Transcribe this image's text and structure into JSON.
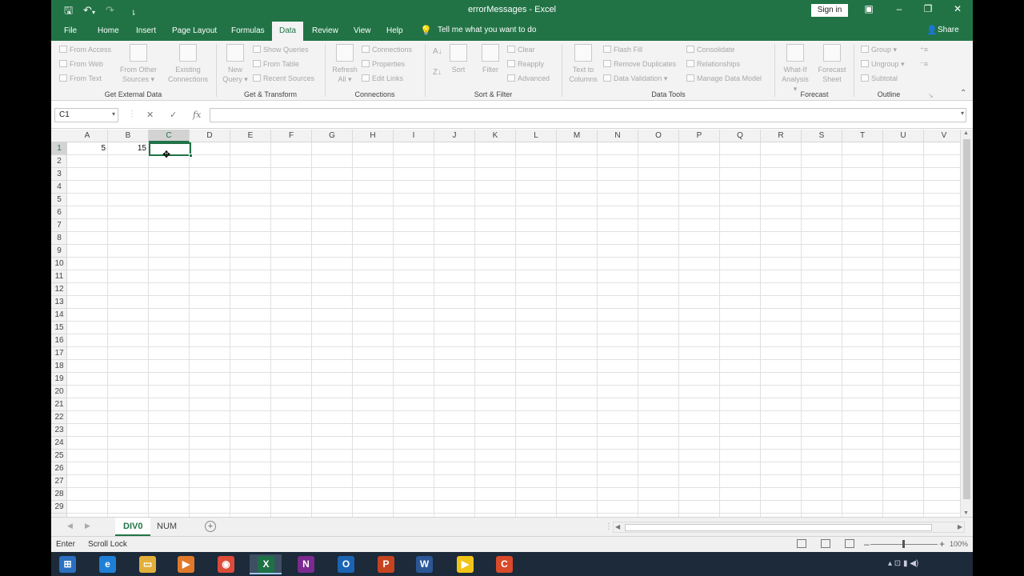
{
  "titlebar": {
    "title": "errorMessages - Excel",
    "sign_in": "Sign in",
    "qa_save_icon": "save-icon",
    "qa_undo_icon": "undo-icon",
    "qa_redo_icon": "redo-icon",
    "qa_customize_icon": "customize-quick-access-icon"
  },
  "tabs": [
    "File",
    "Home",
    "Insert",
    "Page Layout",
    "Formulas",
    "Data",
    "Review",
    "View",
    "Help"
  ],
  "active_tab": "Data",
  "tell_me": "Tell me what you want to do",
  "share": "Share",
  "ribbon": {
    "get_external_data": {
      "label": "Get External Data",
      "from_access": "From Access",
      "from_web": "From Web",
      "from_text": "From Text",
      "from_other_1": "From Other",
      "from_other_2": "Sources",
      "existing_1": "Existing",
      "existing_2": "Connections"
    },
    "get_transform": {
      "label": "Get & Transform",
      "new_query_1": "New",
      "new_query_2": "Query",
      "show_queries": "Show Queries",
      "from_table": "From Table",
      "recent_sources": "Recent Sources"
    },
    "connections": {
      "label": "Connections",
      "refresh_1": "Refresh",
      "refresh_2": "All",
      "connections": "Connections",
      "properties": "Properties",
      "edit_links": "Edit Links"
    },
    "sort_filter": {
      "label": "Sort & Filter",
      "sort": "Sort",
      "filter": "Filter",
      "clear": "Clear",
      "reapply": "Reapply",
      "advanced": "Advanced"
    },
    "data_tools": {
      "label": "Data Tools",
      "text_to_cols_1": "Text to",
      "text_to_cols_2": "Columns",
      "flash_fill": "Flash Fill",
      "remove_duplicates": "Remove Duplicates",
      "data_validation": "Data Validation",
      "consolidate": "Consolidate",
      "relationships": "Relationships",
      "manage_data_model": "Manage Data Model"
    },
    "forecast": {
      "label": "Forecast",
      "what_if_1": "What-If",
      "what_if_2": "Analysis",
      "forecast_sheet_1": "Forecast",
      "forecast_sheet_2": "Sheet"
    },
    "outline": {
      "label": "Outline",
      "group": "Group",
      "ungroup": "Ungroup",
      "subtotal": "Subtotal"
    }
  },
  "formula_bar": {
    "name_box": "C1",
    "cancel_icon": "✕",
    "enter_icon": "✓",
    "fx": "fx",
    "value": ""
  },
  "grid": {
    "columns": [
      "A",
      "B",
      "C",
      "D",
      "E",
      "F",
      "G",
      "H",
      "I",
      "J",
      "K",
      "L",
      "M",
      "N",
      "O",
      "P",
      "Q",
      "R",
      "S",
      "T",
      "U",
      "V"
    ],
    "rows": [
      "1",
      "2",
      "3",
      "4",
      "5",
      "6",
      "7",
      "8",
      "9",
      "10",
      "11",
      "12",
      "13",
      "14",
      "15",
      "16",
      "17",
      "18",
      "19",
      "20",
      "21",
      "22",
      "23",
      "24",
      "25",
      "26",
      "27",
      "28",
      "29"
    ],
    "cells": {
      "A1": "5",
      "B1": "15"
    },
    "active_cell": "C1"
  },
  "sheets": [
    "DIV0",
    "NUM"
  ],
  "active_sheet": "DIV0",
  "status": {
    "mode": "Enter",
    "scroll_lock": "Scroll Lock",
    "zoom": "100%"
  },
  "taskbar": [
    {
      "name": "start",
      "glyph": "⊞",
      "color": "#2a6fc0"
    },
    {
      "name": "internet-explorer",
      "glyph": "e",
      "color": "#1e7fd6"
    },
    {
      "name": "file-explorer",
      "glyph": "▭",
      "color": "#e2b03a"
    },
    {
      "name": "media-player",
      "glyph": "▶",
      "color": "#e07a2a"
    },
    {
      "name": "chrome",
      "glyph": "◉",
      "color": "#dd4b39"
    },
    {
      "name": "excel",
      "glyph": "X",
      "color": "#1e7145"
    },
    {
      "name": "onenote",
      "glyph": "N",
      "color": "#7b2a8f"
    },
    {
      "name": "outlook",
      "glyph": "O",
      "color": "#1b64b4"
    },
    {
      "name": "powerpoint",
      "glyph": "P",
      "color": "#c64320"
    },
    {
      "name": "word",
      "glyph": "W",
      "color": "#2b5797"
    },
    {
      "name": "player",
      "glyph": "▶",
      "color": "#f0c419"
    },
    {
      "name": "camtasia",
      "glyph": "C",
      "color": "#d94a2a"
    }
  ]
}
